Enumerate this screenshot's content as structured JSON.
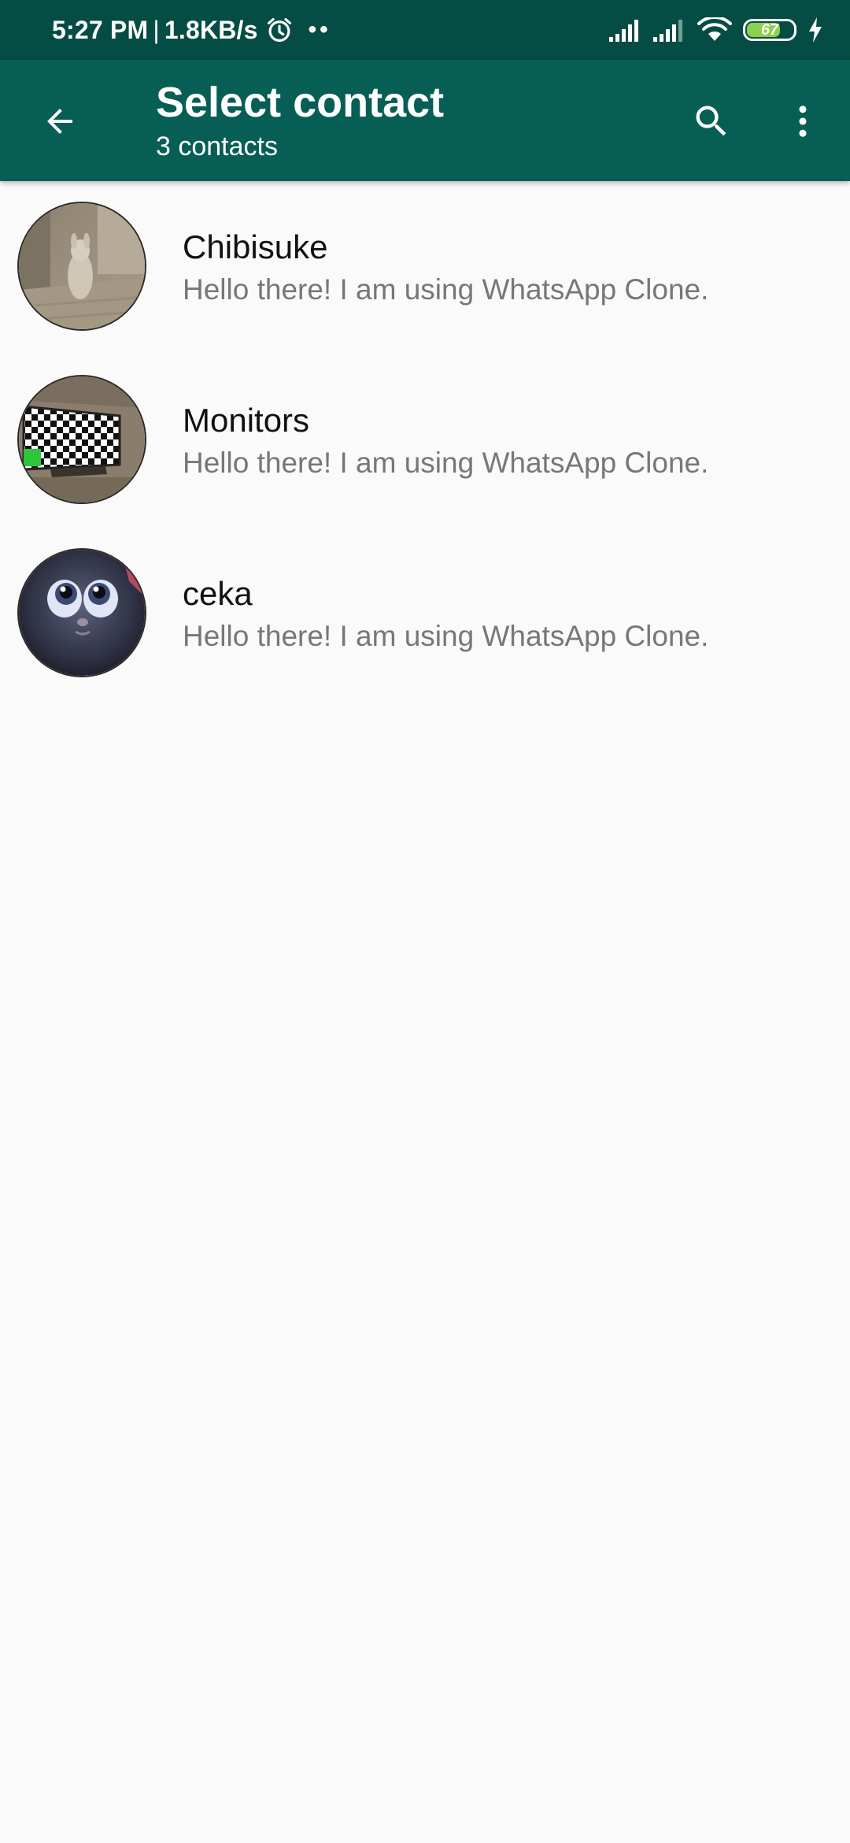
{
  "status_bar": {
    "time": "5:27 PM",
    "separator": "|",
    "net_speed": "1.8KB/s",
    "notification_dots": "••",
    "battery_level": "67",
    "icons": [
      "alarm-icon",
      "signal-icon",
      "signal-icon",
      "wifi-icon",
      "battery-icon",
      "charging-icon"
    ]
  },
  "header": {
    "title": "Select contact",
    "subtitle": "3 contacts",
    "icons": [
      "back-arrow-icon",
      "search-icon",
      "more-vert-icon"
    ]
  },
  "contacts": [
    {
      "name": "Chibisuke",
      "status": "Hello there! I am using WhatsApp Clone."
    },
    {
      "name": "Monitors",
      "status": "Hello there! I am using WhatsApp Clone."
    },
    {
      "name": "ceka",
      "status": "Hello there! I am using WhatsApp Clone."
    }
  ],
  "colors": {
    "status_bar": "#054d44",
    "app_bar": "#075e54",
    "background": "#fafafa",
    "secondary_text": "#777777",
    "battery_fill": "#8bd14b"
  }
}
